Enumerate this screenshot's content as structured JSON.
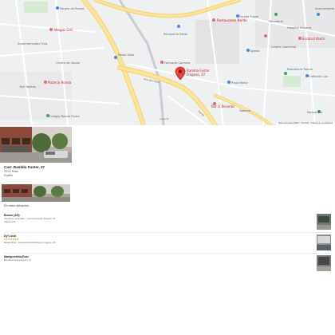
{
  "map": {
    "pin_label_line1": "Rambla Fuster",
    "pin_label_line2": "Fragoso, 37",
    "labels": [
      "Parque da Ronda",
      "Meigas Grill",
      "Supermercados Froiz",
      "Centro de Saúde",
      "Pizzeria Ronda",
      "Bar Tapitas",
      "Colegio Ronda Fuster",
      "Paseo Vilas",
      "Farmacia Carmela",
      "Peluquería Estilo",
      "Restaurante Nardo",
      "Parada Fuster",
      "Panadería",
      "Hospital General",
      "Escola Infantil",
      "Aparcamento",
      "Iglesia",
      "Centro Comercial",
      "Praza Maior",
      "Bar O Recanto",
      "Residencia Ronda",
      "Cafetería Lúa",
      "Taberna",
      "Parque Sur"
    ],
    "road_labels": [
      "Rúa de Fuster",
      "Autovía",
      "Ronda"
    ],
    "footer": "Datos del mapa ©2024 · Términos · Informar de un problema"
  },
  "address": {
    "title": "Carr. Rambla Fuster, 37",
    "city": "36700 Ribas",
    "country": "España"
  },
  "nearby": {
    "heading": "En esta ubicación",
    "places": [
      {
        "name": "Bonus (3/5)",
        "rating": "",
        "line1": "Tienda de recambios · Carretera Fuster Fragoso, 37",
        "line2": "Abierto 24h"
      },
      {
        "name": "Dy'Local",
        "rating": "4,3 ★★★★★",
        "line1": "Restaurante · Carretera Rambla Fuster Fragoso, 39",
        "line2": ""
      },
      {
        "name": "Manipostería Ruiz",
        "rating": "",
        "line1": "Rambla Fuster Fragoso, 37",
        "line2": ""
      }
    ]
  }
}
